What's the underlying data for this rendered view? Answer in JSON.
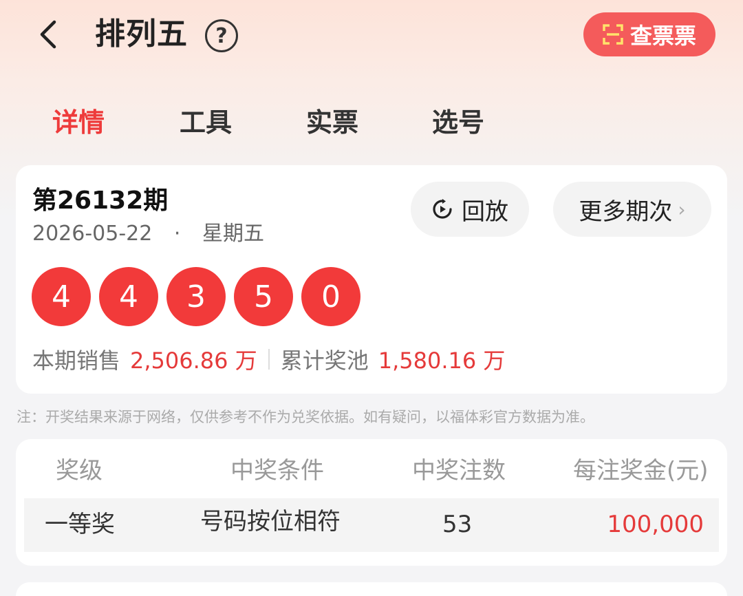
{
  "header": {
    "title": "排列五",
    "help_symbol": "?",
    "check_ticket_label": "查票票"
  },
  "tabs": [
    {
      "label": "详情",
      "active": true
    },
    {
      "label": "工具",
      "active": false
    },
    {
      "label": "实票",
      "active": false
    },
    {
      "label": "选号",
      "active": false
    }
  ],
  "draw": {
    "issue": "第26132期",
    "date": "2026-05-22",
    "separator": "·",
    "weekday": "星期五",
    "replay_label": "回放",
    "more_label": "更多期次",
    "numbers": [
      "4",
      "4",
      "3",
      "5",
      "0"
    ],
    "sales_label": "本期销售",
    "sales_value": "2,506.86 万",
    "pool_label": "累计奖池",
    "pool_value": "1,580.16 万"
  },
  "note": "注：开奖结果来源于网络，仅供参考不作为兑奖依据。如有疑问，以福体彩官方数据为准。",
  "prize_table": {
    "headers": [
      "奖级",
      "中奖条件",
      "中奖注数",
      "每注奖金(元)"
    ],
    "rows": [
      {
        "level": "一等奖",
        "condition": "号码按位相符",
        "count": "53",
        "amount": "100,000"
      }
    ]
  },
  "colors": {
    "accent_red": "#ee3b3b",
    "ball_red": "#f23a3a",
    "button_red": "#f45b5b"
  }
}
